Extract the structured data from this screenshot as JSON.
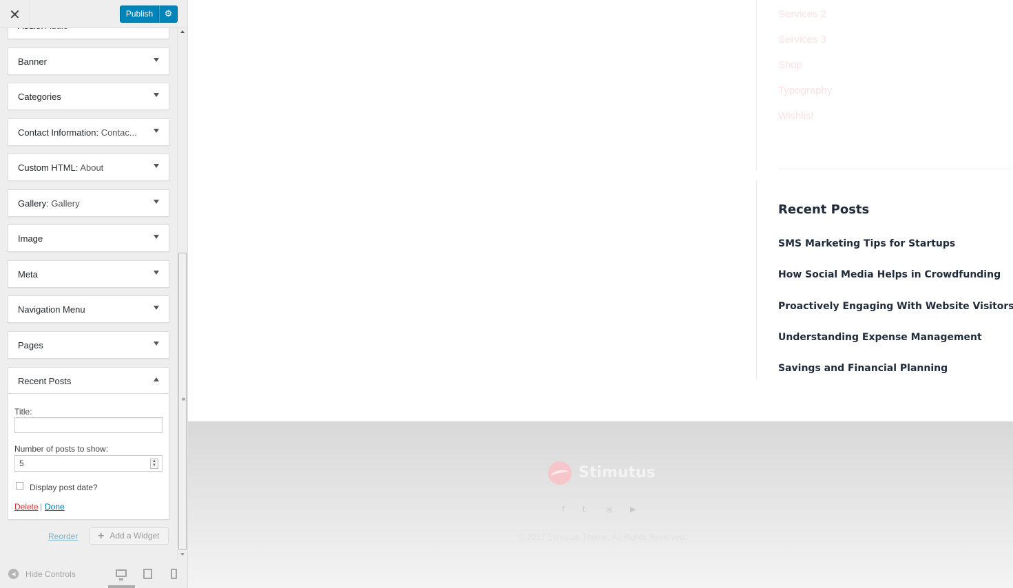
{
  "header": {
    "close_label": "✕",
    "publish_label": "Publish",
    "settings_icon": "⚙"
  },
  "widgets": [
    {
      "name": "Audio",
      "subtitle": "Audio"
    },
    {
      "name": "Banner",
      "subtitle": ""
    },
    {
      "name": "Categories",
      "subtitle": ""
    },
    {
      "name": "Contact Information:",
      "subtitle": "Contac..."
    },
    {
      "name": "Custom HTML:",
      "subtitle": "About"
    },
    {
      "name": "Gallery:",
      "subtitle": "Gallery"
    },
    {
      "name": "Image",
      "subtitle": ""
    },
    {
      "name": "Meta",
      "subtitle": ""
    },
    {
      "name": "Navigation Menu",
      "subtitle": ""
    },
    {
      "name": "Pages",
      "subtitle": ""
    }
  ],
  "recent_widget": {
    "name": "Recent Posts",
    "title_label": "Title:",
    "title_value": "",
    "number_label": "Number of posts to show:",
    "number_value": "5",
    "date_label": "Display post date?",
    "delete_label": "Delete",
    "separator": "|",
    "done_label": "Done"
  },
  "actions": {
    "reorder_label": "Reorder",
    "add_widget_label": "Add a Widget"
  },
  "footer_controls": {
    "hide_label": "Hide Controls"
  },
  "preview": {
    "pages": [
      "Services 2",
      "Services 3",
      "Shop",
      "Typography",
      "Wishlist"
    ],
    "recent_posts_heading": "Recent Posts",
    "recent_posts": [
      "SMS Marketing Tips for Startups",
      "How Social Media Helps in Crowdfunding",
      "Proactively Engaging With Website Visitors",
      "Understanding Expense Management",
      "Savings and Financial Planning"
    ],
    "footer": {
      "logo_text": "Stimutus",
      "social": [
        "f",
        "t",
        "◎",
        "▶"
      ],
      "copyright": "© 2017 Stimutus Theme. All Rights Reserved."
    }
  },
  "colors": {
    "publish": "#0085ba",
    "delete": "#dc3232",
    "link": "#0073aa",
    "pink_accent": "#f6c6cb"
  }
}
